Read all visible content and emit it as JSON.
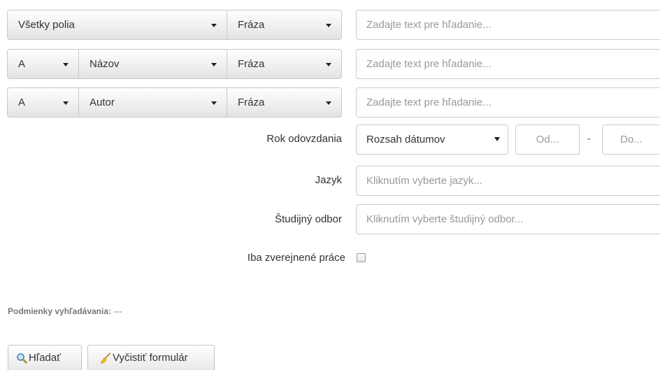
{
  "rows": [
    {
      "field": "Všetky polia",
      "match": "Fráza",
      "placeholder": "Zadajte text pre hľadanie..."
    },
    {
      "operator": "A",
      "field": "Názov",
      "match": "Fráza",
      "placeholder": "Zadajte text pre hľadanie..."
    },
    {
      "operator": "A",
      "field": "Autor",
      "match": "Fráza",
      "placeholder": "Zadajte text pre hľadanie..."
    }
  ],
  "year": {
    "label": "Rok odovzdania",
    "range_mode": "Rozsah dátumov",
    "from_placeholder": "Od...",
    "separator": "-",
    "to_placeholder": "Do..."
  },
  "language": {
    "label": "Jazyk",
    "placeholder": "Kliknutím vyberte jazyk..."
  },
  "study_field": {
    "label": "Študijný odbor",
    "placeholder": "Kliknutím vyberte študijný odbor..."
  },
  "published_only": {
    "label": "Iba zverejnené práce",
    "checked": false
  },
  "conditions": {
    "label": "Podmienky vyhľadávania:",
    "value": "---"
  },
  "buttons": {
    "search": "Hľadať",
    "clear": "Vyčistiť formulár"
  },
  "icons": {
    "search": "magnifier-icon",
    "clear": "broom-icon"
  }
}
